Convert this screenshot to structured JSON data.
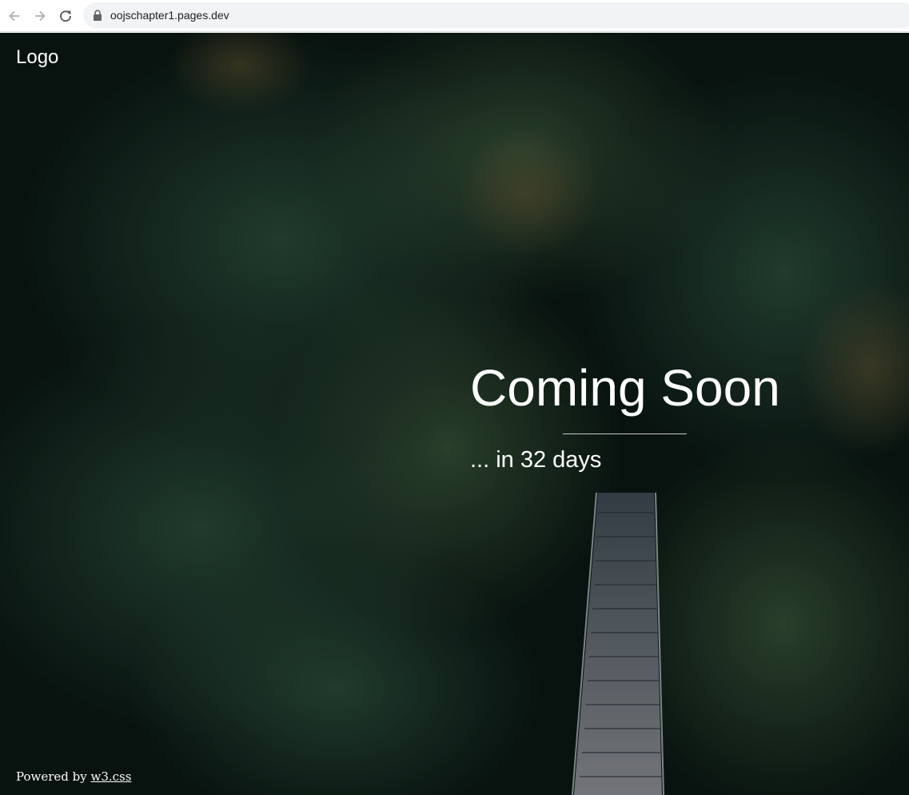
{
  "browser": {
    "url": "oojschapter1.pages.dev",
    "icons": [
      "back-arrow-icon",
      "forward-arrow-icon",
      "reload-icon",
      "lock-icon"
    ]
  },
  "page": {
    "logo_text": "Logo",
    "title": "Coming Soon",
    "subtitle": "... in 32 days",
    "footer_prefix": "Powered by ",
    "footer_link": "w3.css"
  },
  "colors": {
    "text": "#ffffff",
    "forest_dark": "#081410",
    "forest_green": "#1f3b2c"
  }
}
